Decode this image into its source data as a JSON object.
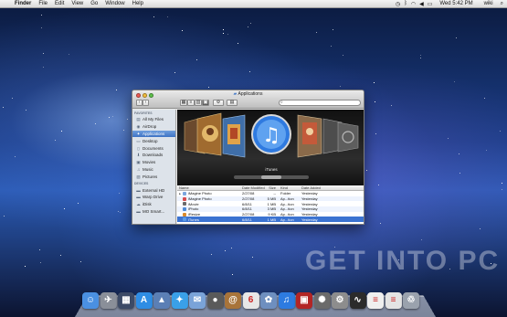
{
  "menubar": {
    "apple": "",
    "items": [
      "Finder",
      "File",
      "Edit",
      "View",
      "Go",
      "Window",
      "Help"
    ],
    "clock": "Wed 5:42 PM",
    "user": "wiki"
  },
  "window": {
    "title": "Applications",
    "search_placeholder": ""
  },
  "sidebar": {
    "favorites_heading": "FAVORITES",
    "favorites": [
      {
        "label": "All My Files",
        "icon": "files-icon"
      },
      {
        "label": "AirDrop",
        "icon": "airdrop-icon"
      },
      {
        "label": "Applications",
        "icon": "applications-icon",
        "selected": true
      },
      {
        "label": "Desktop",
        "icon": "desktop-icon"
      },
      {
        "label": "Documents",
        "icon": "documents-icon"
      },
      {
        "label": "Downloads",
        "icon": "downloads-icon"
      },
      {
        "label": "Movies",
        "icon": "movies-icon"
      },
      {
        "label": "Music",
        "icon": "music-icon"
      },
      {
        "label": "Pictures",
        "icon": "pictures-icon"
      }
    ],
    "devices_heading": "DEVICES",
    "devices": [
      {
        "label": "External HD",
        "icon": "drive-icon"
      },
      {
        "label": "Warp Drive",
        "icon": "drive-icon"
      },
      {
        "label": "iDisk",
        "icon": "idisk-icon"
      },
      {
        "label": "MO Smart...",
        "icon": "drive-icon"
      }
    ]
  },
  "coverflow": {
    "caption": "iTunes"
  },
  "list": {
    "headers": {
      "name": "Name",
      "date": "Date Modified",
      "size": "Size",
      "kind": "Kind",
      "added": "Date Added"
    },
    "rows": [
      {
        "name": "iMagine Photo",
        "date": "2/27/08",
        "size": "--",
        "kind": "Folder",
        "added": "Yesterday",
        "color": "#7aa6de",
        "folder": true
      },
      {
        "name": "iMagine Photo",
        "date": "2/27/08",
        "size": "5 MB",
        "kind": "Ap...tion",
        "added": "Yesterday",
        "color": "#d94b4b"
      },
      {
        "name": "iMovie",
        "date": "6/8/11",
        "size": "1 MB",
        "kind": "Ap...tion",
        "added": "Yesterday",
        "color": "#6a6a6a"
      },
      {
        "name": "iPhoto",
        "date": "6/8/11",
        "size": "3 MB",
        "kind": "Ap...tion",
        "added": "Yesterday",
        "color": "#4e8ad6"
      },
      {
        "name": "iResize",
        "date": "2/27/08",
        "size": "9 KB",
        "kind": "Ap...tion",
        "added": "Yesterday",
        "color": "#d98a2b"
      },
      {
        "name": "iTunes",
        "date": "6/8/11",
        "size": "1 MB",
        "kind": "Ap...tion",
        "added": "Yesterday",
        "color": "#5a9be6",
        "selected": true
      }
    ]
  },
  "watermark": "GET INTO PC",
  "dock": [
    {
      "name": "finder-icon",
      "glyph": "☺",
      "color": "#4a90e2"
    },
    {
      "name": "launchpad-icon",
      "glyph": "✈",
      "color": "#8a8f99"
    },
    {
      "name": "mission-control-icon",
      "glyph": "▦",
      "color": "#3c4a66"
    },
    {
      "name": "app-store-icon",
      "glyph": "A",
      "color": "#2f8de4"
    },
    {
      "name": "preview-icon",
      "glyph": "▲",
      "color": "#5b7fb5"
    },
    {
      "name": "safari-icon",
      "glyph": "✦",
      "color": "#3aa0e8"
    },
    {
      "name": "mail-icon",
      "glyph": "✉",
      "color": "#7aa3d8"
    },
    {
      "name": "facetime-icon",
      "glyph": "●",
      "color": "#5a5a5a"
    },
    {
      "name": "address-book-icon",
      "glyph": "@",
      "color": "#a8743a"
    },
    {
      "name": "ical-icon",
      "glyph": "6",
      "color": "#e7e7e7"
    },
    {
      "name": "preview-photos-icon",
      "glyph": "✿",
      "color": "#6e8fbf"
    },
    {
      "name": "itunes-icon",
      "glyph": "♫",
      "color": "#2d7be0"
    },
    {
      "name": "photo-booth-icon",
      "glyph": "▣",
      "color": "#b32525"
    },
    {
      "name": "iphoto-icon",
      "glyph": "✺",
      "color": "#6b6b6b"
    },
    {
      "name": "system-preferences-icon",
      "glyph": "⚙",
      "color": "#8d8d8d"
    },
    {
      "name": "activity-monitor-icon",
      "glyph": "∿",
      "color": "#2b2b2b"
    },
    {
      "name": "document-icon",
      "glyph": "≡",
      "color": "#efefef"
    },
    {
      "name": "document-icon-2",
      "glyph": "≡",
      "color": "#e4e4e4"
    },
    {
      "name": "trash-icon",
      "glyph": "♲",
      "color": "#9aa2ad"
    }
  ]
}
